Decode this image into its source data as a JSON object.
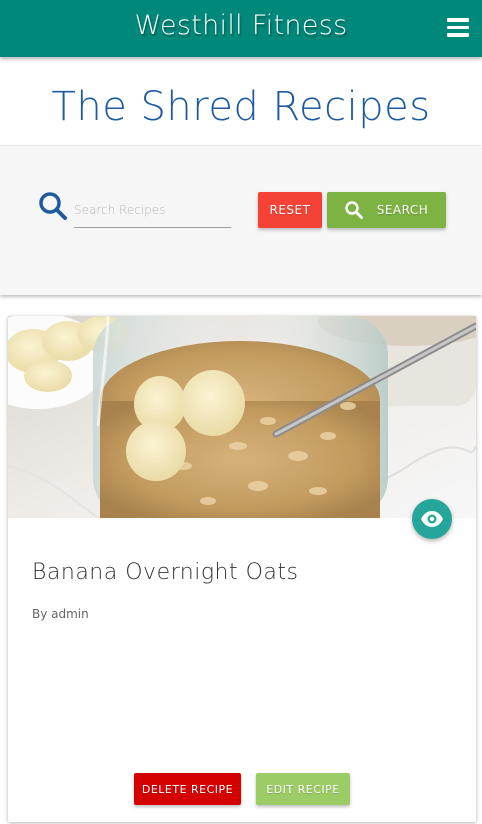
{
  "navbar": {
    "brand": "Westhill Fitness",
    "menu_icon": "hamburger-menu-icon"
  },
  "page": {
    "title": "The Shred Recipes"
  },
  "search": {
    "icon": "search-icon",
    "placeholder": "Search Recipes",
    "value": "",
    "reset_label": "Reset",
    "search_label": "Search"
  },
  "recipes": [
    {
      "title": "Banana Overnight Oats",
      "author": "By admin",
      "view_icon": "eye-icon",
      "delete_label": "Delete Recipe",
      "edit_label": "Edit Recipe"
    }
  ],
  "colors": {
    "navbar": "#00897b",
    "title": "#1e5aa0",
    "reset": "#f44336",
    "search": "#7cb342",
    "delete": "#d50000",
    "edit": "#9ccc65",
    "fab": "#26a69a"
  }
}
